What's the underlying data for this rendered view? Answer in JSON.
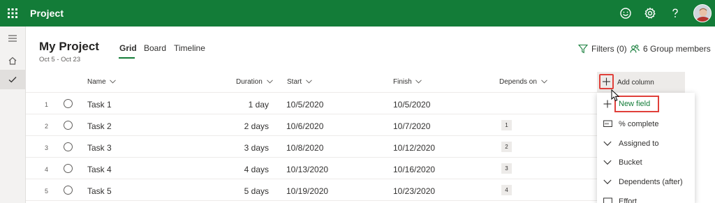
{
  "app": {
    "title": "Project",
    "brand_color": "#137c38"
  },
  "topbar_icons": [
    "smiley-icon",
    "gear-icon",
    "help-icon",
    "avatar"
  ],
  "rail_icons": [
    "hamburger-icon",
    "home-icon",
    "check-icon"
  ],
  "project": {
    "title": "My Project",
    "dates": "Oct 5 - Oct 23"
  },
  "tabs": [
    {
      "label": "Grid",
      "active": true
    },
    {
      "label": "Board",
      "active": false
    },
    {
      "label": "Timeline",
      "active": false
    }
  ],
  "header_actions": {
    "filters": "Filters (0)",
    "members": "6 Group members"
  },
  "columns": {
    "name": "Name",
    "duration": "Duration",
    "start": "Start",
    "finish": "Finish",
    "depends_on": "Depends on",
    "add_column": "Add column"
  },
  "tasks": [
    {
      "num": "1",
      "name": "Task 1",
      "duration": "1 day",
      "start": "10/5/2020",
      "finish": "10/5/2020",
      "depends": ""
    },
    {
      "num": "2",
      "name": "Task 2",
      "duration": "2 days",
      "start": "10/6/2020",
      "finish": "10/7/2020",
      "depends": "1"
    },
    {
      "num": "3",
      "name": "Task 3",
      "duration": "3 days",
      "start": "10/8/2020",
      "finish": "10/12/2020",
      "depends": "2"
    },
    {
      "num": "4",
      "name": "Task 4",
      "duration": "4 days",
      "start": "10/13/2020",
      "finish": "10/16/2020",
      "depends": "3"
    },
    {
      "num": "5",
      "name": "Task 5",
      "duration": "5 days",
      "start": "10/19/2020",
      "finish": "10/23/2020",
      "depends": "4"
    }
  ],
  "menu": [
    {
      "label": "New field",
      "icon": "plus-icon"
    },
    {
      "label": "% complete",
      "icon": "number-field-icon"
    },
    {
      "label": "Assigned to",
      "icon": "chevron-down-icon"
    },
    {
      "label": "Bucket",
      "icon": "chevron-down-icon"
    },
    {
      "label": "Dependents (after)",
      "icon": "chevron-down-icon"
    },
    {
      "label": "Effort",
      "icon": "number-field-icon"
    }
  ]
}
